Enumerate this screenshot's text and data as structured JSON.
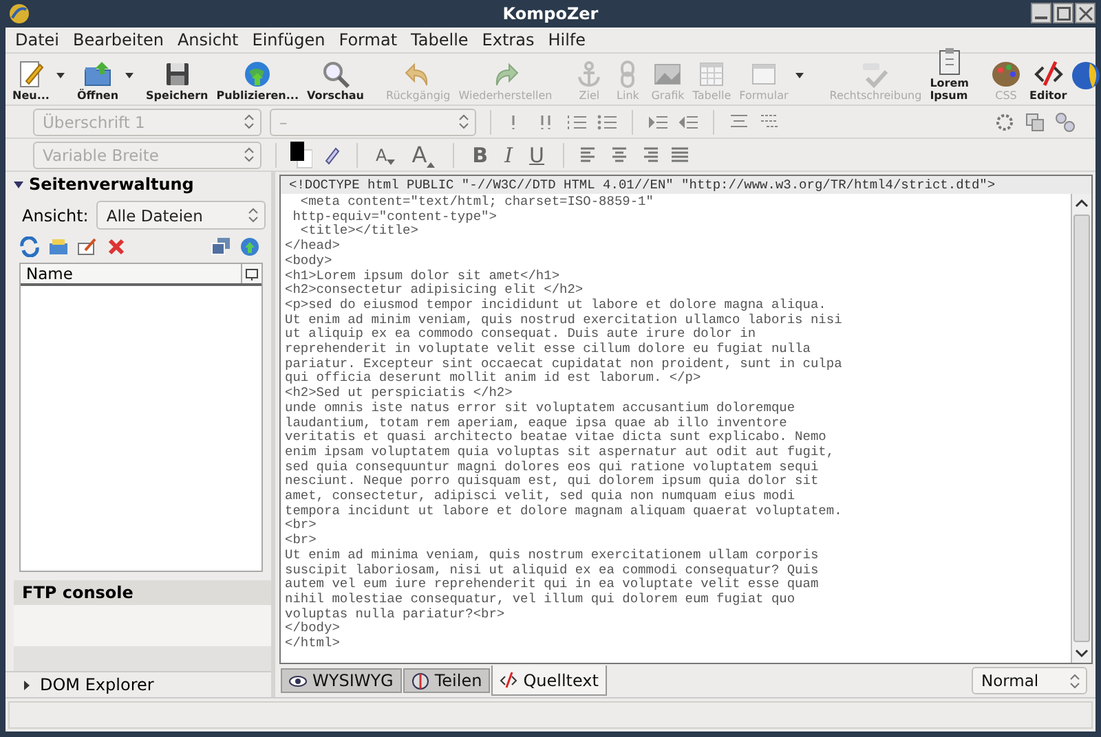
{
  "window": {
    "title": "KompoZer"
  },
  "menu": [
    {
      "label": "Datei"
    },
    {
      "label": "Bearbeiten"
    },
    {
      "label": "Ansicht"
    },
    {
      "label": "Einfügen"
    },
    {
      "label": "Format"
    },
    {
      "label": "Tabelle"
    },
    {
      "label": "Extras"
    },
    {
      "label": "Hilfe"
    }
  ],
  "toolbar": [
    {
      "label": "Neu...",
      "disabled": false,
      "dropdown": true
    },
    {
      "label": "Öffnen",
      "disabled": false,
      "dropdown": true
    },
    {
      "label": "Speichern",
      "disabled": false,
      "dropdown": false
    },
    {
      "label": "Publizieren...",
      "disabled": false,
      "dropdown": false
    },
    {
      "label": "Vorschau",
      "disabled": false,
      "dropdown": false
    },
    {
      "label": "Rückgängig",
      "disabled": true,
      "dropdown": false
    },
    {
      "label": "Wiederherstellen",
      "disabled": true,
      "dropdown": false
    },
    {
      "label": "Ziel",
      "disabled": true,
      "dropdown": false
    },
    {
      "label": "Link",
      "disabled": true,
      "dropdown": false
    },
    {
      "label": "Grafik",
      "disabled": true,
      "dropdown": false
    },
    {
      "label": "Tabelle",
      "disabled": true,
      "dropdown": false
    },
    {
      "label": "Formular",
      "disabled": true,
      "dropdown": true
    },
    {
      "label": "Rechtschreibung",
      "disabled": true,
      "dropdown": false
    },
    {
      "label": "Lorem Ipsum",
      "disabled": false,
      "dropdown": false
    },
    {
      "label": "CSS",
      "disabled": true,
      "dropdown": false
    },
    {
      "label": "Editor",
      "disabled": false,
      "dropdown": false
    }
  ],
  "format_bar": {
    "paragraph_style": "Überschrift 1",
    "font": "–",
    "width": "Variable Breite",
    "disabled": true,
    "size_buttons": [
      {
        "label": "A"
      },
      {
        "label": "A"
      }
    ],
    "style_buttons": [
      {
        "label": "B",
        "kind": "bold"
      },
      {
        "label": "I",
        "kind": "italic"
      },
      {
        "label": "U",
        "kind": "underline"
      }
    ]
  },
  "side_panel": {
    "title": "Seitenverwaltung",
    "expanded": true,
    "view_label": "Ansicht:",
    "view": "Alle Dateien",
    "column": "Name"
  },
  "ftp_console": {
    "title": "FTP console"
  },
  "dom_explorer": {
    "title": "DOM Explorer",
    "expanded": false
  },
  "source": {
    "header": "<!DOCTYPE html PUBLIC \"-//W3C//DTD HTML 4.01//EN\" \"http://www.w3.org/TR/html4/strict.dtd\">",
    "lines": [
      "  <meta content=\"text/html; charset=ISO-8859-1\"",
      " http-equiv=\"content-type\">",
      "  <title></title>",
      "</head>",
      "<body>",
      "<h1>Lorem ipsum dolor sit amet</h1>",
      "<h2>consectetur adipisicing elit </h2>",
      "<p>sed do eiusmod tempor incididunt ut labore et dolore magna aliqua.",
      "Ut enim ad minim veniam, quis nostrud exercitation ullamco laboris nisi",
      "ut aliquip ex ea commodo consequat. Duis aute irure dolor in",
      "reprehenderit in voluptate velit esse cillum dolore eu fugiat nulla",
      "pariatur. Excepteur sint occaecat cupidatat non proident, sunt in culpa",
      "qui officia deserunt mollit anim id est laborum. </p>",
      "<h2>Sed ut perspiciatis </h2>",
      "unde omnis iste natus error sit voluptatem accusantium doloremque",
      "laudantium, totam rem aperiam, eaque ipsa quae ab illo inventore",
      "veritatis et quasi architecto beatae vitae dicta sunt explicabo. Nemo",
      "enim ipsam voluptatem quia voluptas sit aspernatur aut odit aut fugit,",
      "sed quia consequuntur magni dolores eos qui ratione voluptatem sequi",
      "nesciunt. Neque porro quisquam est, qui dolorem ipsum quia dolor sit",
      "amet, consectetur, adipisci velit, sed quia non numquam eius modi",
      "tempora incidunt ut labore et dolore magnam aliquam quaerat voluptatem.",
      "<br>",
      "<br>",
      "Ut enim ad minima veniam, quis nostrum exercitationem ullam corporis",
      "suscipit laboriosam, nisi ut aliquid ex ea commodi consequatur? Quis",
      "autem vel eum iure reprehenderit qui in ea voluptate velit esse quam",
      "nihil molestiae consequatur, vel illum qui dolorem eum fugiat quo",
      "voluptas nulla pariatur?<br>",
      "</body>",
      "</html>"
    ]
  },
  "view_tabs": [
    {
      "label": "WYSIWYG",
      "selected": false
    },
    {
      "label": "Teilen",
      "selected": false
    },
    {
      "label": "Quelltext",
      "selected": true
    }
  ],
  "mode": {
    "value": "Normal"
  }
}
